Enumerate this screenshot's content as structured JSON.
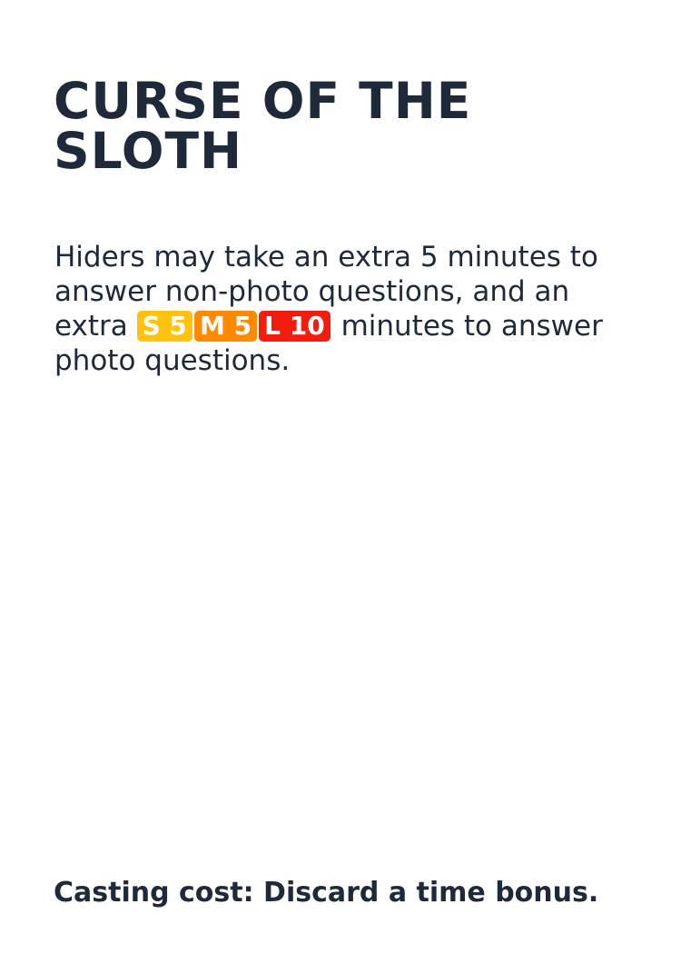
{
  "card": {
    "title_line1": "CURSE OF THE",
    "title_line2": "SLOTH",
    "body_part1": "Hiders may take an extra 5 minutes to answer non-photo questions, and an extra",
    "badges": [
      {
        "label": "S 5",
        "color": "#ffc20e"
      },
      {
        "label": "M 5",
        "color": "#ff8a00"
      },
      {
        "label": "L 10",
        "color": "#f21d0e"
      }
    ],
    "body_part2": "minutes to answer photo questions.",
    "casting_cost": "Casting cost: Discard a time bonus."
  },
  "colors": {
    "text": "#1e2a3a",
    "background": "#ffffff"
  }
}
